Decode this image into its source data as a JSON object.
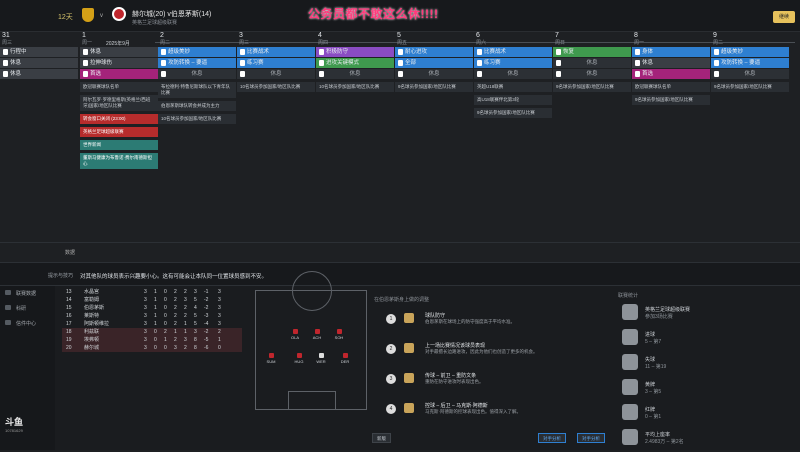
{
  "topbar": {
    "days": "12天",
    "match": "赫尔城(20) v伯恩茅斯(14)",
    "competition": "英格兰足球超级联赛",
    "banner": "公务员都不敢这么休!!!!",
    "right_button": "继续",
    "vs": "v"
  },
  "days": [
    {
      "num": "31",
      "name": "周三",
      "slots": [
        {
          "label": "行程中",
          "cls": "s-grey"
        },
        {
          "label": "休息",
          "cls": "s-grey"
        },
        {
          "label": "休息",
          "cls": "s-grey"
        }
      ],
      "cards": []
    },
    {
      "num": "1",
      "name": "周一",
      "month": "2025年9月",
      "slots": [
        {
          "label": "休息",
          "cls": "s-grey"
        },
        {
          "label": "拉伸球伤",
          "cls": "s-grey"
        },
        {
          "label": "首选",
          "cls": "s-pink"
        }
      ],
      "cards": [
        {
          "text": "欧冠联赛球队名单",
          "cls": ""
        },
        {
          "text": "阿尔瓦罗·罗德里格斯(英格兰/西班牙)国家/地区队比赛",
          "cls": ""
        },
        {
          "text": "转会窗口关闭 (23:00)",
          "cls": "red"
        },
        {
          "text": "英格兰足球超级联赛",
          "cls": "red"
        },
        {
          "text": "世界新闻",
          "cls": "teal"
        },
        {
          "text": "董斯马健康为布鲁诺·费尔南德斯担心",
          "cls": "teal"
        }
      ]
    },
    {
      "num": "2",
      "name": "周二",
      "slots": [
        {
          "label": "超级美妙",
          "cls": "s-blue"
        },
        {
          "label": "攻防转换 – 要逼",
          "cls": "s-blue"
        },
        {
          "label": "休息",
          "cls": "s-rest"
        }
      ],
      "cards": [
        {
          "text": "布拉德利·特鲁尼斯球队以下青年队比赛",
          "cls": ""
        },
        {
          "text": "伯恩茅斯球队转会并成为主力",
          "cls": ""
        },
        {
          "text": "10名球员参加国家/地区队比赛",
          "cls": ""
        }
      ]
    },
    {
      "num": "3",
      "name": "周三",
      "slots": [
        {
          "label": "比赛战术",
          "cls": "s-blue"
        },
        {
          "label": "练习赛",
          "cls": "s-blue"
        },
        {
          "label": "休息",
          "cls": "s-rest"
        }
      ],
      "cards": [
        {
          "text": "10名球员参加国家/地区队比赛",
          "cls": ""
        }
      ]
    },
    {
      "num": "4",
      "name": "周四",
      "slots": [
        {
          "label": "积极防守",
          "cls": "s-purple"
        },
        {
          "label": "进攻关键模式",
          "cls": "s-green"
        },
        {
          "label": "休息",
          "cls": "s-rest"
        }
      ],
      "cards": [
        {
          "text": "10名球员参加国家/地区队比赛",
          "cls": ""
        }
      ]
    },
    {
      "num": "5",
      "name": "周五",
      "slots": [
        {
          "label": "耐心进攻",
          "cls": "s-blue"
        },
        {
          "label": "全部",
          "cls": "s-blue"
        },
        {
          "label": "休息",
          "cls": "s-rest"
        }
      ],
      "cards": [
        {
          "text": "9名球员参加国家/地区队比赛",
          "cls": ""
        }
      ]
    },
    {
      "num": "6",
      "name": "周六",
      "slots": [
        {
          "label": "比赛战术",
          "cls": "s-blue"
        },
        {
          "label": "练习赛",
          "cls": "s-blue"
        },
        {
          "label": "休息",
          "cls": "s-rest"
        }
      ],
      "cards": [
        {
          "text": "英超U18联赛",
          "cls": ""
        },
        {
          "text": "高U18联赛伴北第3轮",
          "cls": ""
        },
        {
          "text": "9名球员参加国家/地区队比赛",
          "cls": ""
        }
      ]
    },
    {
      "num": "7",
      "name": "周日",
      "slots": [
        {
          "label": "恢复",
          "cls": "s-green"
        },
        {
          "label": "休息",
          "cls": "s-rest"
        },
        {
          "label": "休息",
          "cls": "s-rest"
        }
      ],
      "cards": [
        {
          "text": "9名球员参加国家/地区队比赛",
          "cls": ""
        }
      ]
    },
    {
      "num": "8",
      "name": "周一",
      "slots": [
        {
          "label": "身体",
          "cls": "s-blue"
        },
        {
          "label": "休息",
          "cls": "s-grey"
        },
        {
          "label": "首选",
          "cls": "s-pink"
        }
      ],
      "cards": [
        {
          "text": "欧冠联赛球队名单",
          "cls": ""
        },
        {
          "text": "9名球员参加国家/地区队比赛",
          "cls": ""
        }
      ]
    },
    {
      "num": "9",
      "name": "周二",
      "slots": [
        {
          "label": "超级美妙",
          "cls": "s-blue"
        },
        {
          "label": "攻防转换 – 要逼",
          "cls": "s-blue"
        },
        {
          "label": "休息",
          "cls": "s-rest"
        }
      ],
      "cards": [
        {
          "text": "9名球员参加国家/地区队比赛",
          "cls": ""
        }
      ]
    }
  ],
  "separator_label": "数据",
  "tip": {
    "label": "提示与技巧",
    "text": "对其他队的球员表示兴趣要小心。这有可能会让本队同一位置球员感到不安。"
  },
  "sidebar": [
    {
      "label": "联赛数据"
    },
    {
      "label": "科研"
    },
    {
      "label": "信件中心"
    }
  ],
  "logo": {
    "main": "斗鱼",
    "sub": "10781629"
  },
  "league_table": [
    {
      "pos": "13",
      "team": "水晶宫",
      "p": "3",
      "w": "1",
      "d": "0",
      "l": "2",
      "f": "2",
      "a": "3",
      "gd": "-1",
      "pts": "3",
      "rel": false
    },
    {
      "pos": "14",
      "team": "富勒姆",
      "p": "3",
      "w": "1",
      "d": "0",
      "l": "2",
      "f": "3",
      "a": "5",
      "gd": "-2",
      "pts": "3",
      "rel": false
    },
    {
      "pos": "15",
      "team": "伯恩茅斯",
      "p": "3",
      "w": "1",
      "d": "0",
      "l": "2",
      "f": "2",
      "a": "4",
      "gd": "-2",
      "pts": "3",
      "rel": false
    },
    {
      "pos": "16",
      "team": "莱斯特",
      "p": "3",
      "w": "1",
      "d": "0",
      "l": "2",
      "f": "2",
      "a": "5",
      "gd": "-3",
      "pts": "3",
      "rel": false
    },
    {
      "pos": "17",
      "team": "阿斯顿维拉",
      "p": "3",
      "w": "1",
      "d": "0",
      "l": "2",
      "f": "1",
      "a": "5",
      "gd": "-4",
      "pts": "3",
      "rel": false
    },
    {
      "pos": "18",
      "team": "利兹联",
      "p": "3",
      "w": "0",
      "d": "2",
      "l": "1",
      "f": "1",
      "a": "3",
      "gd": "-2",
      "pts": "2",
      "rel": true
    },
    {
      "pos": "19",
      "team": "埃弗顿",
      "p": "3",
      "w": "0",
      "d": "1",
      "l": "2",
      "f": "3",
      "a": "8",
      "gd": "-5",
      "pts": "1",
      "rel": true
    },
    {
      "pos": "20",
      "team": "赫尔城",
      "p": "3",
      "w": "0",
      "d": "0",
      "l": "3",
      "f": "2",
      "a": "8",
      "gd": "-6",
      "pts": "0",
      "rel": true
    }
  ],
  "pitch_players": [
    {
      "name": "OLA",
      "cls": ""
    },
    {
      "name": "ACH",
      "cls": ""
    },
    {
      "name": "SOH",
      "cls": ""
    },
    {
      "name": "SUM",
      "cls": ""
    },
    {
      "name": "HUG",
      "cls": ""
    },
    {
      "name": "WER",
      "cls": "w"
    },
    {
      "name": "DER",
      "cls": ""
    }
  ],
  "tactics": {
    "header": "在伯恩茅斯身上做的调整",
    "items": [
      {
        "num": "1",
        "t1": "球队防守",
        "t2": "伯恩茅斯在球场上的防守强度高于平均水准。"
      },
      {
        "num": "2",
        "t1": "上一场比赛情况该球员表现",
        "t2": "对手最擅长边路进攻，因此为他们也创造了更多的机会。"
      },
      {
        "num": "3",
        "t1": "传球 – 前卫 – 重防文条",
        "t2": "重防在防守进攻时表现出色。"
      },
      {
        "num": "4",
        "t1": "控球 – 后卫 – 马克斯·阿德斯",
        "t2": "马克斯·阿德斯的控球表现出色。值得深入了解。"
      }
    ],
    "buttons": {
      "new": "新版",
      "report": "对手分析",
      "analysis": "对手分析"
    }
  },
  "stats": {
    "header": "联赛统计",
    "items": [
      {
        "a": "英格兰足球超级联赛",
        "b": "参加3场比赛"
      },
      {
        "a": "进球",
        "b": "5 – 第7"
      },
      {
        "a": "失球",
        "b": "11 – 第19"
      },
      {
        "a": "黄牌",
        "b": "3 – 第5"
      },
      {
        "a": "红牌",
        "b": "0 – 第1"
      },
      {
        "a": "平均上座率",
        "b": "2.4983万 – 第2名"
      }
    ]
  }
}
